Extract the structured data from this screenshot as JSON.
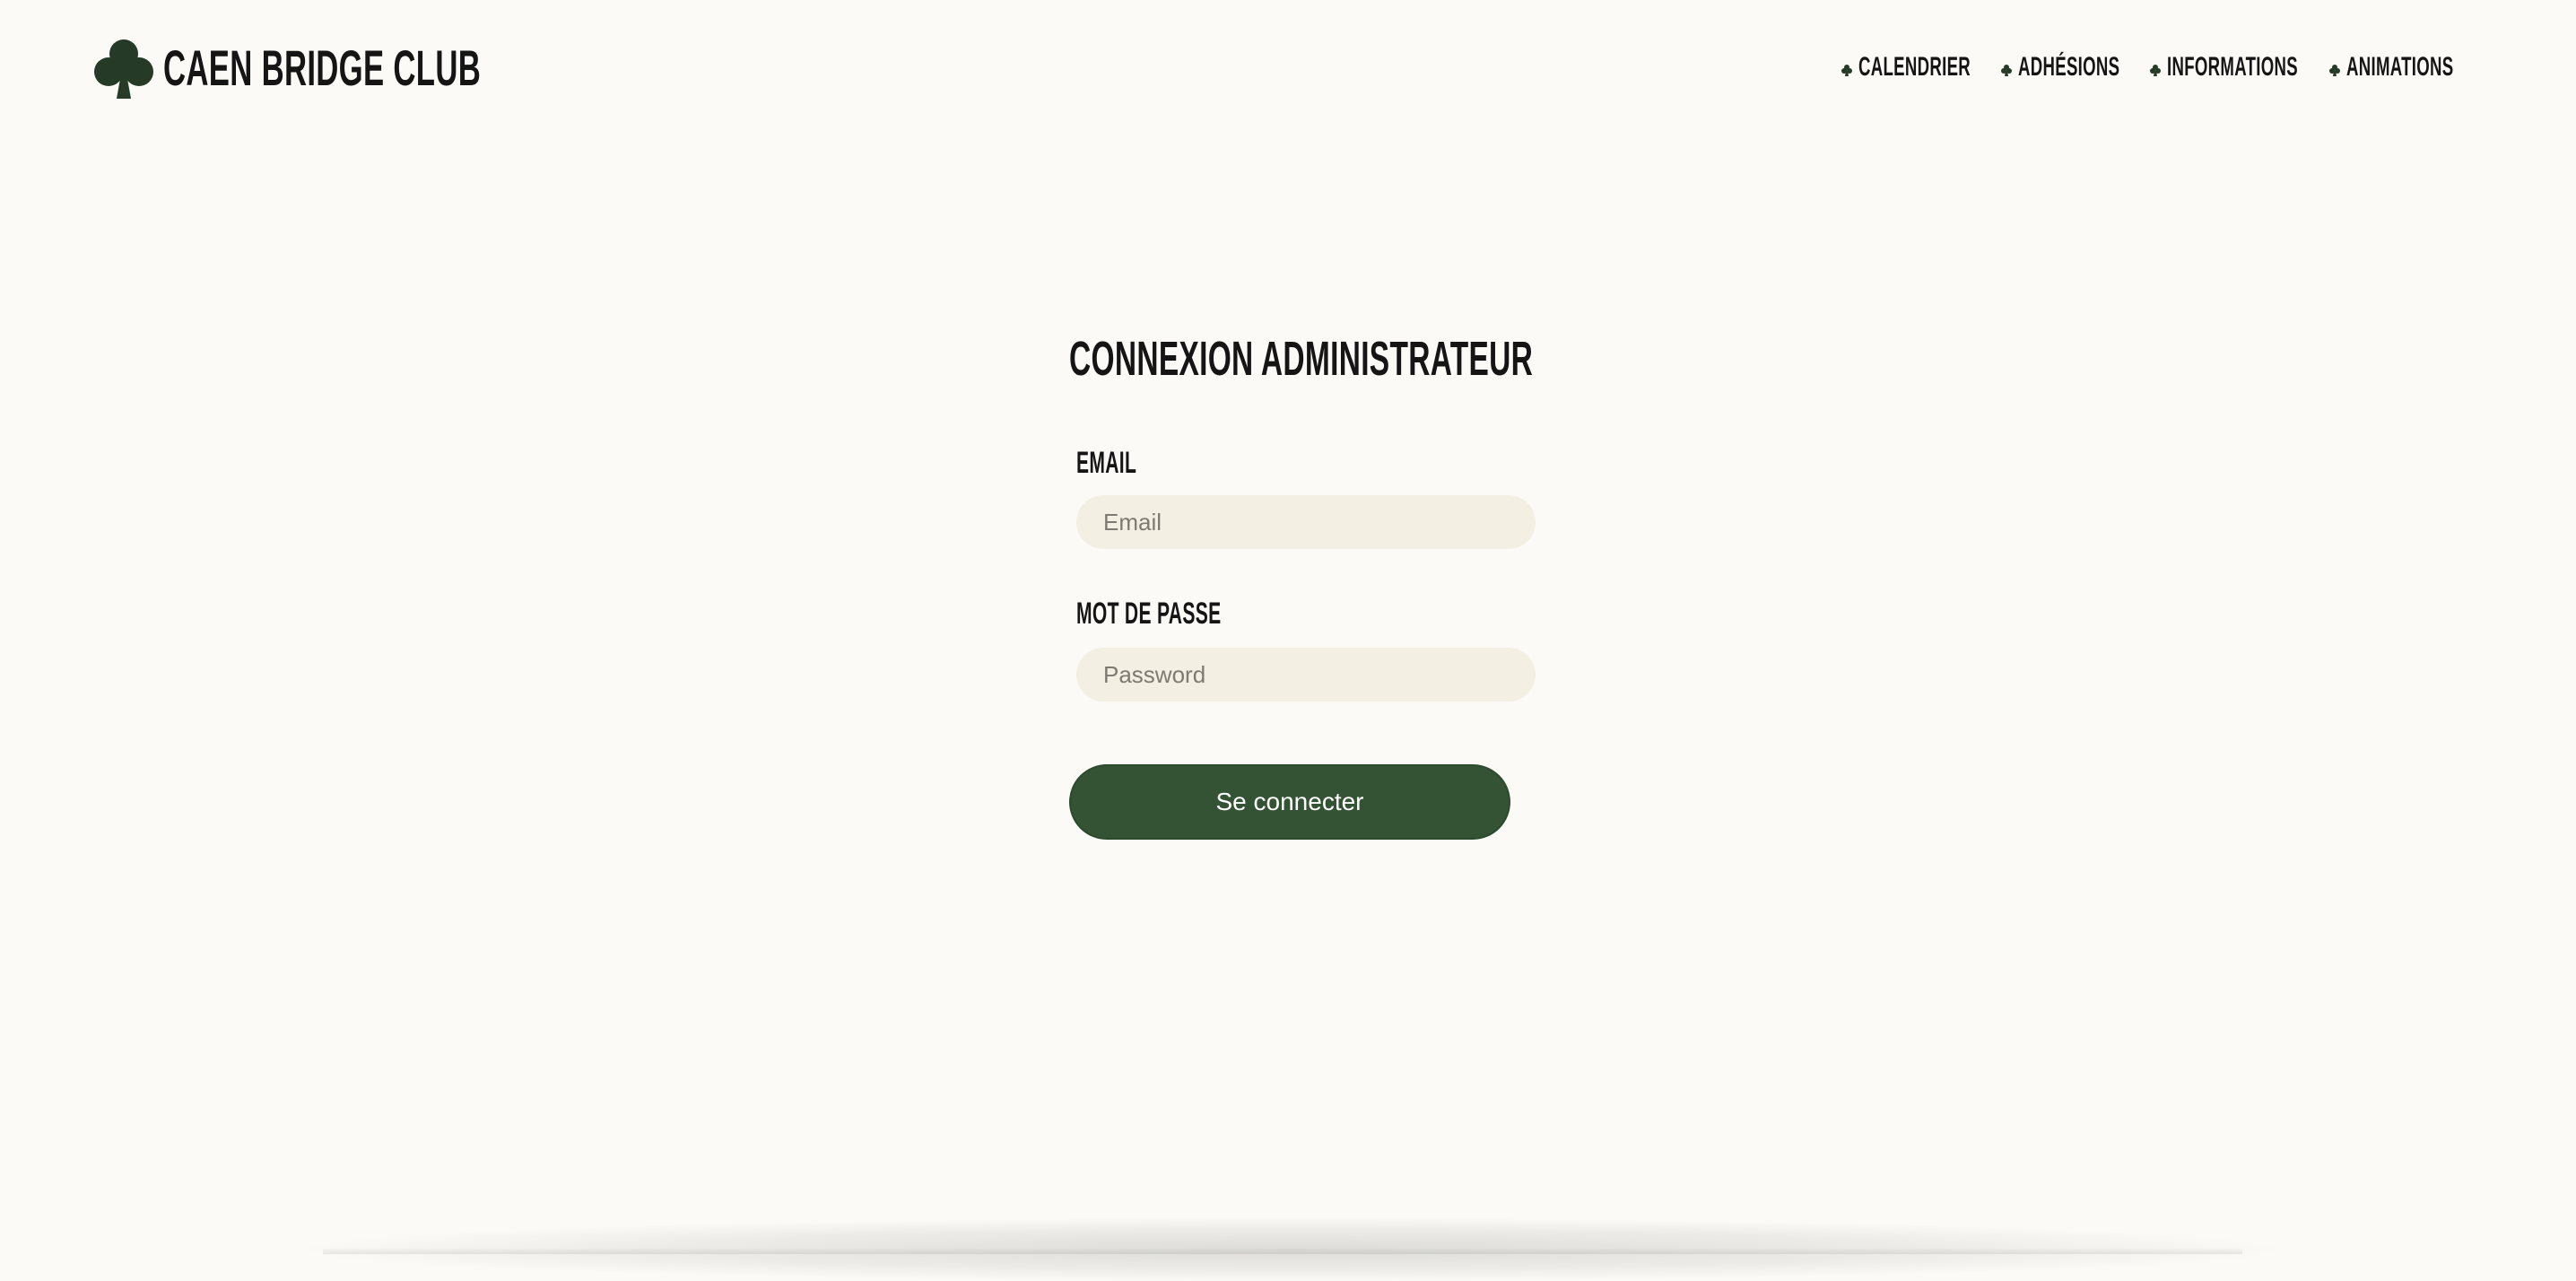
{
  "header": {
    "brand_icon": "club-suit-icon",
    "brand_title": "CAEN BRIDGE CLUB",
    "nav": [
      {
        "label": "CALENDRIER",
        "icon": "club-suit-icon"
      },
      {
        "label": "ADHÉSIONS",
        "icon": "club-suit-icon"
      },
      {
        "label": "INFORMATIONS",
        "icon": "club-suit-icon"
      },
      {
        "label": "ANIMATIONS",
        "icon": "club-suit-icon"
      }
    ]
  },
  "login": {
    "title": "CONNEXION ADMINISTRATEUR",
    "email_label": "EMAIL",
    "email_placeholder": "Email",
    "email_value": "",
    "password_label": "MOT DE PASSE",
    "password_placeholder": "Password",
    "password_value": "",
    "submit_label": "Se connecter"
  },
  "colors": {
    "background": "#fbfaf6",
    "brand_green": "#345334",
    "input_background": "#f3efe3",
    "text": "#151515"
  }
}
